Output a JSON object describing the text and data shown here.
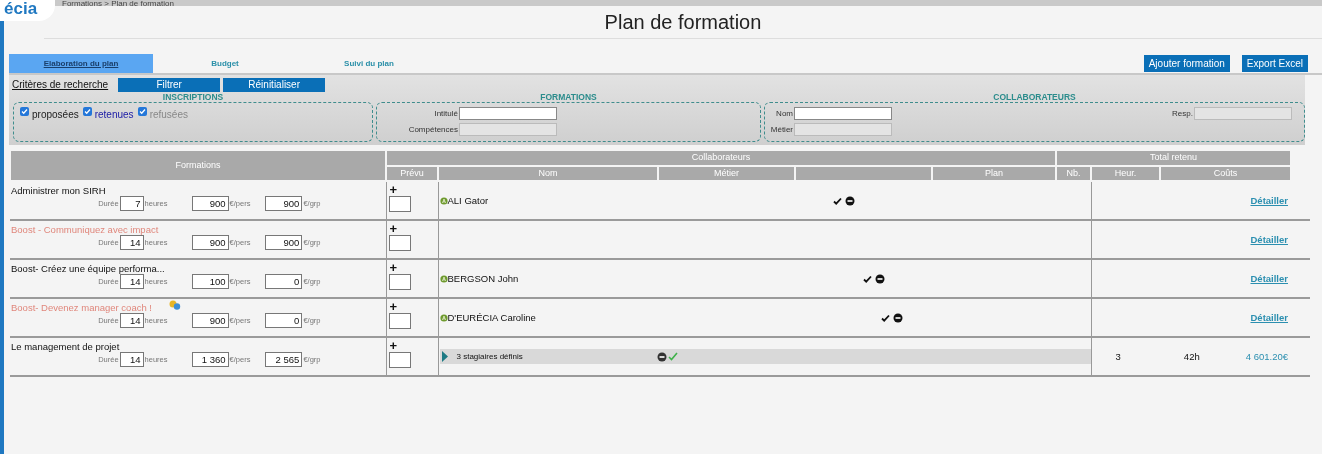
{
  "header": {
    "logo": "écia",
    "breadcrumb": "Formations > Plan de formation"
  },
  "page_title": "Plan de formation",
  "tabs": [
    {
      "label": "Elaboration du plan",
      "selected": true
    },
    {
      "label": "Budget",
      "selected": false
    },
    {
      "label": "Suivi du plan",
      "selected": false
    }
  ],
  "actions": [
    "Ajouter formation",
    "Export Excel"
  ],
  "criteria": {
    "label": "Critères de recherche",
    "buttons": [
      "Filtrer",
      "Réinitialiser"
    ],
    "inscriptions": {
      "title": "INSCRIPTIONS",
      "options": [
        {
          "label": "proposées",
          "checked": true,
          "kind": "proposed"
        },
        {
          "label": "retenues",
          "checked": true,
          "kind": "retained"
        },
        {
          "label": "refusées",
          "checked": true,
          "kind": "refused"
        }
      ]
    },
    "formations": {
      "title": "FORMATIONS",
      "fields": [
        {
          "label": "Intitulé",
          "disabled": false
        },
        {
          "label": "Compétences",
          "disabled": true
        }
      ]
    },
    "collaborateurs": {
      "title": "COLLABORATEURS",
      "fields": [
        {
          "label": "Nom",
          "disabled": false
        },
        {
          "label": "Métier",
          "disabled": true
        },
        {
          "label": "Resp.",
          "disabled": true
        }
      ]
    }
  },
  "table": {
    "group_headers": [
      "Formations",
      "Collaborateurs",
      "Total retenu"
    ],
    "columns": [
      "Prévu",
      "Nom",
      "Métier",
      "Plan",
      "Nb.",
      "Heur.",
      "Coûts"
    ],
    "rows": [
      {
        "title": "Administrer mon SIRH",
        "faded": false,
        "linked": false,
        "duration_label": "Durée",
        "duration": "7",
        "hours_label": "heures",
        "per_person": "900",
        "per_person_label": "€/pers",
        "per_group": "900",
        "per_group_label": "€/grp",
        "add": "+",
        "collab": {
          "kind": "person",
          "name": "ALI Gator"
        },
        "total": {
          "kind": "link",
          "label": "Détailler"
        }
      },
      {
        "title": "Boost - Communiquez avec impact",
        "faded": true,
        "linked": false,
        "duration_label": "Durée",
        "duration": "14",
        "hours_label": "heures",
        "per_person": "900",
        "per_person_label": "€/pers",
        "per_group": "900",
        "per_group_label": "€/grp",
        "add": "+",
        "collab": {
          "kind": "none"
        },
        "total": {
          "kind": "link",
          "label": "Détailler"
        }
      },
      {
        "title": "Boost- Créez une équipe performa...",
        "faded": false,
        "linked": false,
        "duration_label": "Durée",
        "duration": "14",
        "hours_label": "heures",
        "per_person": "100",
        "per_person_label": "€/pers",
        "per_group": "0",
        "per_group_label": "€/grp",
        "add": "+",
        "collab": {
          "kind": "person",
          "name": "BERGSON John"
        },
        "total": {
          "kind": "link",
          "label": "Détailler"
        }
      },
      {
        "title": "Boost- Devenez manager coach !",
        "faded": true,
        "linked": true,
        "duration_label": "Durée",
        "duration": "14",
        "hours_label": "heures",
        "per_person": "900",
        "per_person_label": "€/pers",
        "per_group": "0",
        "per_group_label": "€/grp",
        "add": "+",
        "collab": {
          "kind": "person",
          "name": "D'EURÉCIA Caroline"
        },
        "total": {
          "kind": "link",
          "label": "Détailler"
        }
      },
      {
        "title": "Le management de projet",
        "faded": false,
        "linked": false,
        "duration_label": "Durée",
        "duration": "14",
        "hours_label": "heures",
        "per_person": "1 360",
        "per_person_label": "€/pers",
        "per_group": "2 565",
        "per_group_label": "€/grp",
        "add": "+",
        "collab": {
          "kind": "group",
          "label": "3 stagiaires définis",
          "expanded": false
        },
        "total": {
          "kind": "totals",
          "nb": "3",
          "hours": "42h",
          "cost": "4 601.20€"
        }
      }
    ]
  }
}
